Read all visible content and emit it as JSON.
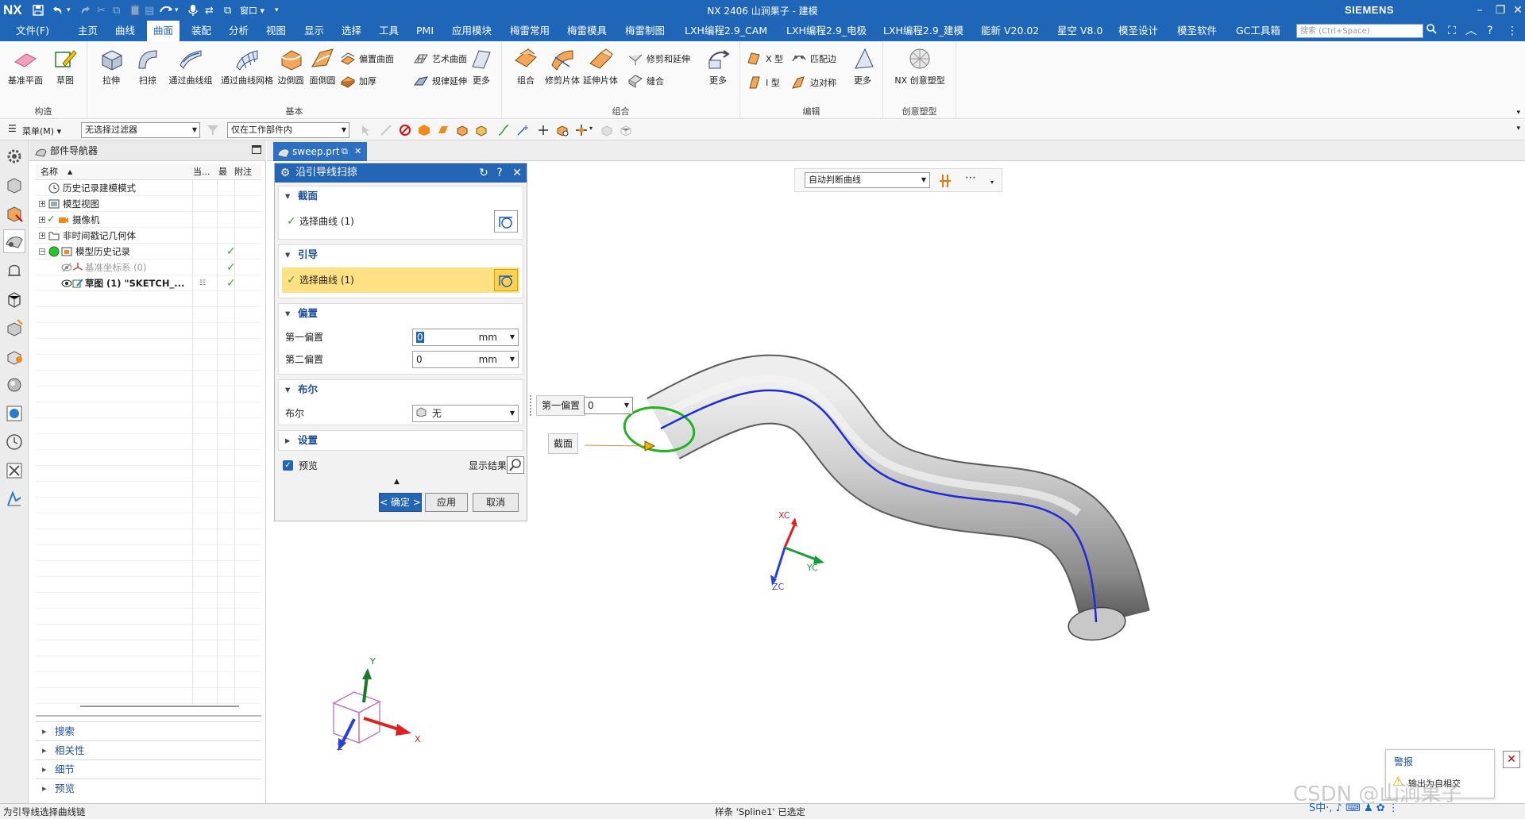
{
  "titlebar": {
    "logo": "NX",
    "title": "NX 2406 山涧果子 - 建模",
    "brand": "SIEMENS",
    "window_label": "窗口",
    "minimize": "–",
    "restore": "❐",
    "close": "✕"
  },
  "menubar": {
    "items": [
      "文件(F)",
      "主页",
      "曲线",
      "曲面",
      "装配",
      "分析",
      "视图",
      "显示",
      "选择",
      "工具",
      "PMI",
      "应用模块",
      "梅雷常用",
      "梅雷模具",
      "梅雷制图",
      "LXH编程2.9_CAM",
      "LXH编程2.9_电极",
      "LXH编程2.9_建模",
      "能新 V20.02",
      "星空 V8.0",
      "模圣设计",
      "模圣软件",
      "GC工具箱"
    ],
    "active": "曲面",
    "search_placeholder": "搜索 (Ctrl+Space)"
  },
  "ribbon": {
    "groups": [
      {
        "label": "构造",
        "buttons": [
          "基准平面",
          "草图"
        ]
      },
      {
        "label": "基本",
        "buttons": [
          "拉伸",
          "扫掠",
          "通过曲线组",
          "通过曲线网格",
          "边倒圆",
          "面倒圆"
        ],
        "small": [
          "偏置曲面",
          "加厚",
          "艺术曲面",
          "规律延伸"
        ],
        "more": "更多"
      },
      {
        "label": "组合",
        "buttons": [
          "组合",
          "修剪片体",
          "延伸片体"
        ],
        "small": [
          "修剪和延伸",
          "缝合"
        ],
        "more": "更多"
      },
      {
        "label": "编辑",
        "small": [
          "X 型",
          "I 型",
          "匹配边",
          "边对称"
        ],
        "more": "更多"
      },
      {
        "label": "创意塑型",
        "buttons": [
          "NX 创意塑型"
        ]
      }
    ]
  },
  "selbar": {
    "menu": "菜单(M)",
    "filter": "无选择过滤器",
    "scope": "仅在工作部件内"
  },
  "navigator": {
    "title": "部件导航器",
    "columns": [
      "名称",
      "当...",
      "最",
      "附注"
    ],
    "rows": [
      {
        "label": "历史记录建模模式",
        "check": ""
      },
      {
        "label": "模型视图",
        "check": ""
      },
      {
        "label": "摄像机",
        "check": ""
      },
      {
        "label": "非时间戳记几何体",
        "check": ""
      },
      {
        "label": "模型历史记录",
        "check": "✓"
      },
      {
        "label": "基准坐标系 (0)",
        "check": "✓"
      },
      {
        "label": "草图 (1) \"SKETCH_...",
        "check": "✓"
      }
    ],
    "sections": [
      "搜索",
      "相关性",
      "细节",
      "预览"
    ]
  },
  "tab": {
    "label": "sweep.prt",
    "close": "✕"
  },
  "dialog": {
    "title": "沿引导线扫掠",
    "section_profile": "截面",
    "profile_select": "选择曲线 (1)",
    "section_guide": "引导",
    "guide_select": "选择曲线 (1)",
    "section_offset": "偏置",
    "offset1_label": "第一偏置",
    "offset1_value": "0",
    "offset2_label": "第二偏置",
    "offset2_value": "0",
    "unit": "mm",
    "section_boolean": "布尔",
    "boolean_label": "布尔",
    "boolean_value": "无",
    "section_settings": "设置",
    "preview_label": "预览",
    "show_result": "显示结果",
    "ok": "< 确定 >",
    "apply": "应用",
    "cancel": "取消"
  },
  "graphics": {
    "curve_rule": "自动判断曲线",
    "float_offset_label": "第一偏置",
    "float_offset_value": "0",
    "float_section_label": "截面",
    "triad": {
      "xc": "XC",
      "yc": "YC",
      "zc": "ZC"
    },
    "view_triad": {
      "x": "X",
      "y": "Y",
      "z": "Z"
    },
    "colors": {
      "tube": "#a9a9a9",
      "guide": "#1e2bd6",
      "section": "#1fb31f"
    }
  },
  "status": {
    "left": "为引导线选择曲线链",
    "middle": "样条 'Spline1' 已选定"
  },
  "alert": {
    "title": "警报",
    "message": "输出为自相交"
  },
  "watermark": "CSDN @山涧果子",
  "ime": "S中·, ♪ ⌨ ♟ ✿ ⋮"
}
